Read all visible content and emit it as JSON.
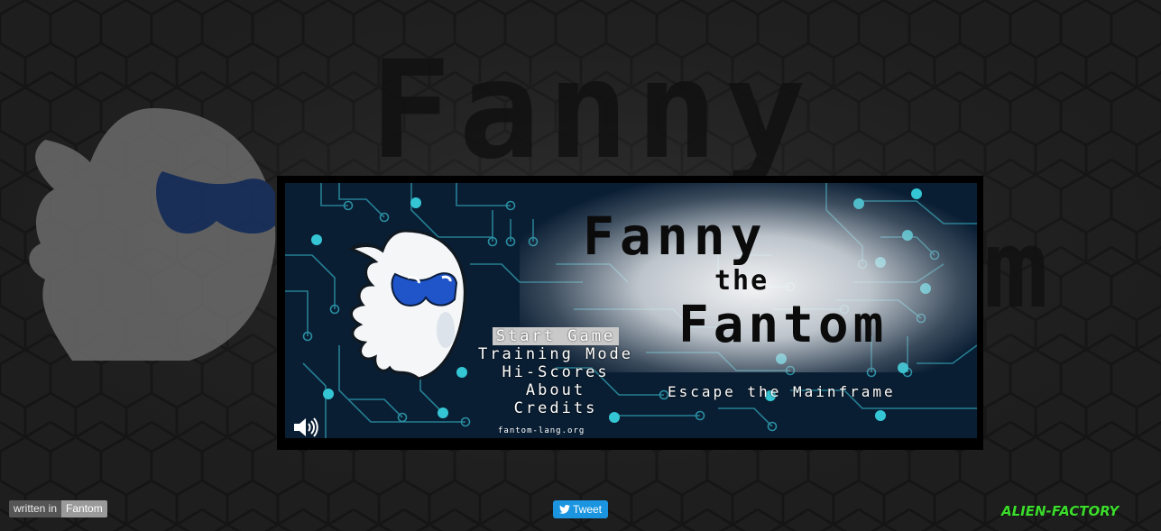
{
  "background": {
    "title_word_1": "Fanny",
    "title_fragment": "m"
  },
  "game": {
    "title_line_1": "Fanny",
    "title_line_2": "the",
    "title_line_3": "Fantom",
    "subtitle": "Escape the Mainframe",
    "menu": [
      {
        "label": "Start Game",
        "selected": true
      },
      {
        "label": "Training Mode",
        "selected": false
      },
      {
        "label": "Hi-Scores",
        "selected": false
      },
      {
        "label": "About",
        "selected": false
      },
      {
        "label": "Credits",
        "selected": false
      }
    ],
    "site": "fantom-lang.org",
    "sound_icon": "speaker-icon"
  },
  "footer": {
    "written_in": "written in",
    "language": "Fantom",
    "tweet": "Tweet",
    "brand": "ALIEN-FACTORY"
  },
  "colors": {
    "brand_green": "#3bdc2c",
    "tweet_blue": "#1b95e0",
    "screen_bg": "#0a1e33",
    "circuit": "#2fa6b8",
    "ghost_eyes": "#1a4fb0"
  }
}
